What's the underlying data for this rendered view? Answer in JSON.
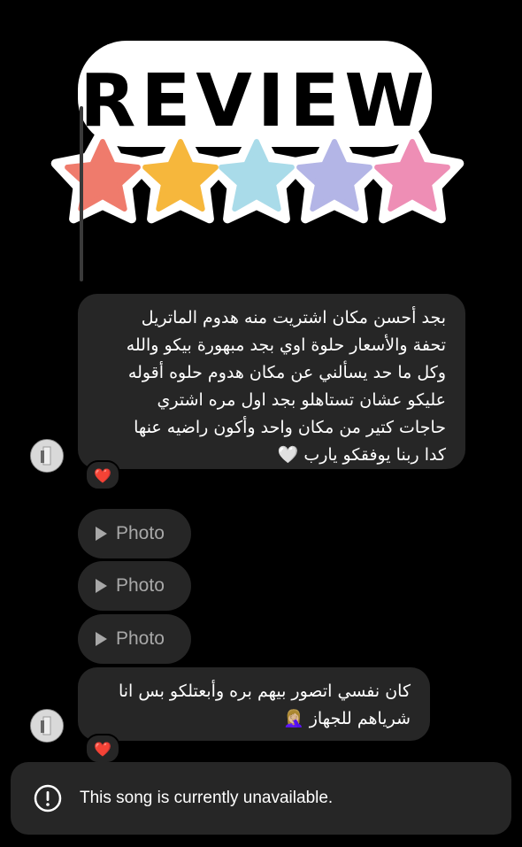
{
  "sticker": {
    "title": "REVIEW",
    "stars": [
      "#ef7b6c",
      "#f6b73c",
      "#a9dbe9",
      "#b3b5e6",
      "#ee8eb5"
    ]
  },
  "messages": [
    {
      "text": "بجد أحسن مكان اشتريت منه هدوم الماتريل\nتحفة والأسعار حلوة اوي بجد مبهورة بيكو والله\nوكل ما حد يسألني عن مكان هدوم حلوه أقوله\nعليكو عشان تستاهلو بجد اول مره اشتري\nحاجات كتير من مكان واحد وأكون راضيه عنها\nكدا ربنا يوفقكو يارب 🤍",
      "reaction": "❤️"
    },
    {
      "text": "كان نفسي اتصور بيهم بره وأبعتلكو بس انا\nشرياهم للجهاز 🤦🏼‍♀️",
      "reaction": "❤️"
    }
  ],
  "photos": [
    "Photo",
    "Photo",
    "Photo"
  ],
  "toast": {
    "text": "This song is currently unavailable.",
    "icon": "alert-circle-icon"
  },
  "colors": {
    "background": "#000000",
    "bubble": "#262626",
    "muted_text": "#a8a8a8"
  }
}
